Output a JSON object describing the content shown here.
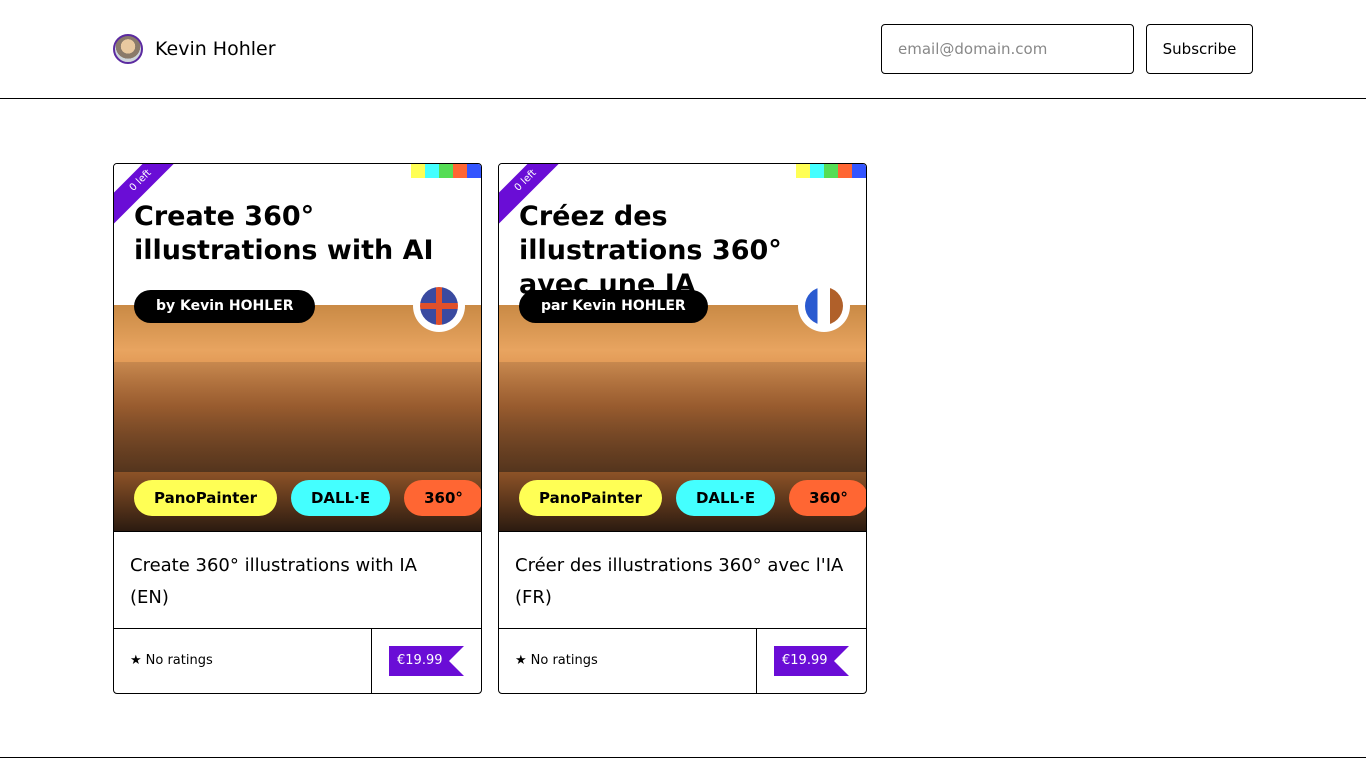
{
  "header": {
    "name": "Kevin Hohler",
    "email_placeholder": "email@domain.com",
    "subscribe_label": "Subscribe"
  },
  "colors": {
    "accent": "#6a0dd6",
    "stripe": [
      "#ffff55",
      "#44ffff",
      "#55dd55",
      "#ff6633",
      "#3355ff"
    ]
  },
  "products": [
    {
      "stock": "0 left",
      "cover_title": "Create 360° illustrations with AI",
      "byline": "by Kevin HOHLER",
      "flag": "uk-flag",
      "tags": [
        "PanoPainter",
        "DALL·E",
        "360°"
      ],
      "title": "Create 360° illustrations with IA (EN)",
      "rating": "No ratings",
      "price": "€19.99"
    },
    {
      "stock": "0 left",
      "cover_title": "Créez des illustrations 360° avec une IA",
      "byline": "par Kevin HOHLER",
      "flag": "france-flag",
      "tags": [
        "PanoPainter",
        "DALL·E",
        "360°"
      ],
      "title": "Créer des illustrations 360° avec l'IA (FR)",
      "rating": "No ratings",
      "price": "€19.99"
    }
  ]
}
